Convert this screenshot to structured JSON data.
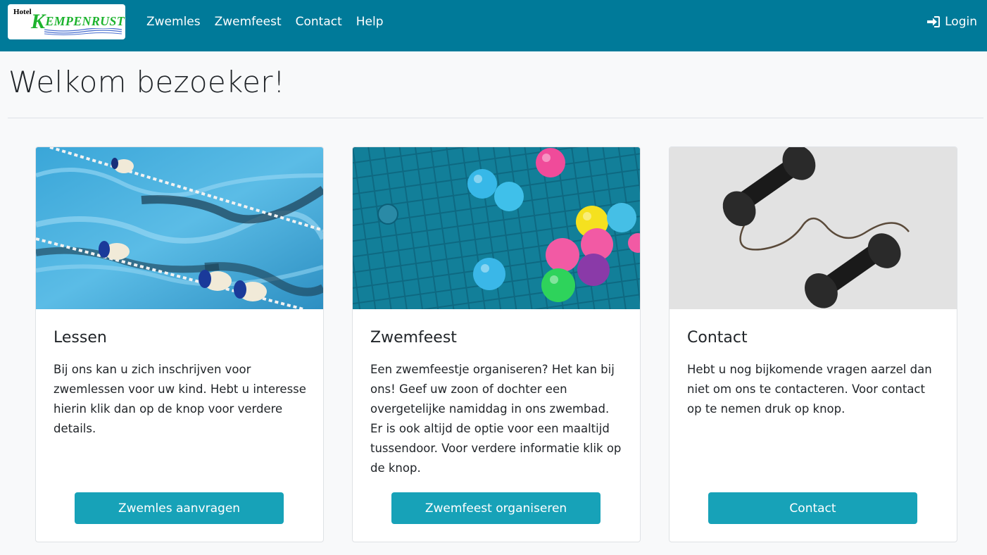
{
  "colors": {
    "navbar": "#007a99",
    "button": "#17a2b8",
    "background": "#f8f9fa",
    "brand_green": "#1db32e"
  },
  "logo": {
    "hotel": "Hotel",
    "brand_first": "K",
    "brand_rest": "EMPENRUST"
  },
  "nav": {
    "links": [
      "Zwemles",
      "Zwemfeest",
      "Contact",
      "Help"
    ],
    "login": "Login",
    "login_icon": "sign-in-icon"
  },
  "page": {
    "title": "Welkom bezoeker!"
  },
  "cards": [
    {
      "image": "swimming-lane-photo",
      "title": "Lessen",
      "text": "Bij ons kan u zich inschrijven voor zwemlessen voor uw kind. Hebt u interesse hierin klik dan op de knop voor verdere details.",
      "button": "Zwemles aanvragen"
    },
    {
      "image": "pool-balls-photo",
      "title": "Zwemfeest",
      "text": "Een zwemfeestje organiseren? Het kan bij ons! Geef uw zoon of dochter een overgetelijke namiddag in ons zwembad. Er is ook altijd de optie voor een maaltijd tussendoor. Voor verdere informatie klik op de knop.",
      "button": "Zwemfeest organiseren"
    },
    {
      "image": "telephone-photo",
      "title": "Contact",
      "text": "Hebt u nog bijkomende vragen aarzel dan niet om ons te contacteren. Voor contact op te nemen druk op knop.",
      "button": "Contact"
    }
  ]
}
